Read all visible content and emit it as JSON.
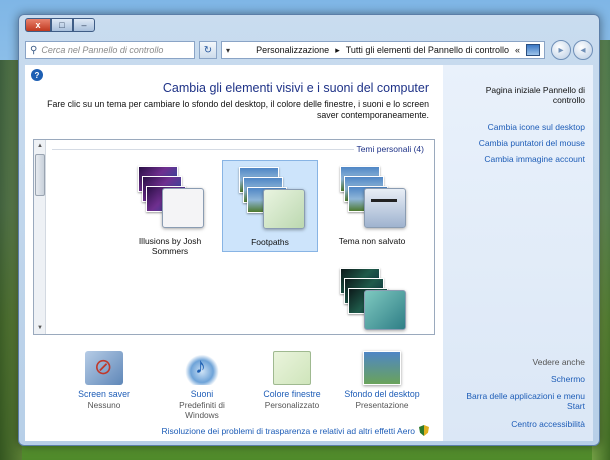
{
  "window": {
    "caption": {
      "close": "x",
      "maximize": "□",
      "minimize": "–"
    }
  },
  "addressbar": {
    "search_placeholder": "Cerca nel Pannello di controllo",
    "refresh": "↻",
    "path": [
      "Tutti gli elementi del Pannello di controllo",
      "Personalizzazione"
    ],
    "separator": "▸",
    "prefix": "«",
    "dropdown": "▾"
  },
  "content": {
    "title": "Cambia gli elementi visivi e i suoni del computer",
    "description": "Fare clic su un tema per cambiare lo sfondo del desktop, il colore delle finestre, i suoni e lo screen saver contemporaneamente.",
    "group_header": "Temi personali (4)",
    "themes": [
      {
        "label": "Tema non salvato"
      },
      {
        "label": "Footpaths"
      },
      {
        "label": "Illusions by Josh Sommers"
      },
      {
        "label": ""
      }
    ],
    "settings": [
      {
        "name": "Sfondo del desktop",
        "value": "Presentazione",
        "icon": "desktop-background-icon"
      },
      {
        "name": "Colore finestre",
        "value": "Personalizzato",
        "icon": "window-color-icon"
      },
      {
        "name": "Suoni",
        "value": "Predefiniti di Windows",
        "icon": "sounds-icon"
      },
      {
        "name": "Screen saver",
        "value": "Nessuno",
        "icon": "screen-saver-icon"
      }
    ],
    "aero_link": "Risoluzione dei problemi di trasparenza e relativi ad altri effetti Aero"
  },
  "sidebar": {
    "home": "Pagina iniziale Pannello di controllo",
    "links": [
      "Cambia icone sul desktop",
      "Cambia puntatori del mouse",
      "Cambia immagine account"
    ],
    "see_also_header": "Vedere anche",
    "see_also": [
      "Schermo",
      "Barra delle applicazioni e menu Start",
      "Centro accessibilità"
    ]
  }
}
